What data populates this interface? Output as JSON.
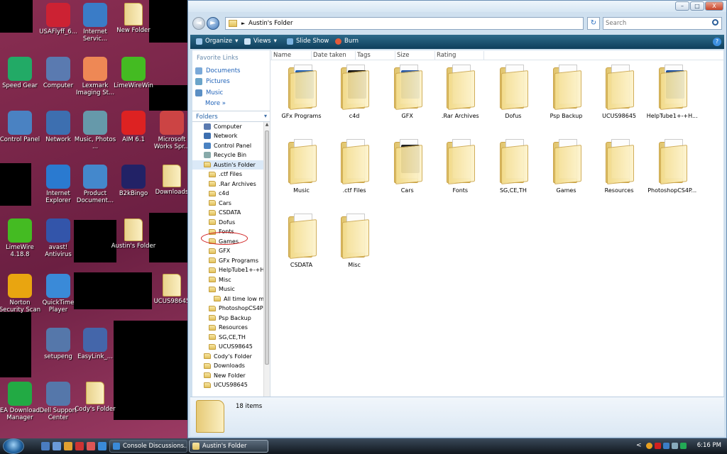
{
  "desktop": {
    "icons": [
      {
        "label": "USAFlyff_6...",
        "col": "#c23"
      },
      {
        "label": "Internet Servic...",
        "col": "#3a7cc7"
      },
      {
        "label": "New Folder",
        "col": "folder"
      },
      {
        "label": "Speed Gear",
        "col": "#2a6"
      },
      {
        "label": "Computer",
        "col": "#5a7ab0"
      },
      {
        "label": "Lexmark Imaging St...",
        "col": "#e85"
      },
      {
        "label": "LimeWireWin",
        "col": "#4b2"
      },
      {
        "label": "Control Panel",
        "col": "#4a82c2"
      },
      {
        "label": "Network",
        "col": "#3d6fb0"
      },
      {
        "label": "Music, Photos ...",
        "col": "#69a"
      },
      {
        "label": "AIM 6.1",
        "col": "#d22"
      },
      {
        "label": "Microsoft Works Spr...",
        "col": "#c44"
      },
      {
        "label": "Internet Explorer",
        "col": "#2a7ad0"
      },
      {
        "label": "Product Document...",
        "col": "#48c"
      },
      {
        "label": "B2kBingo",
        "col": "#226"
      },
      {
        "label": "Downloads",
        "col": "folder"
      },
      {
        "label": "LimeWire 4.18.8",
        "col": "#4b2"
      },
      {
        "label": "avast! Antivirus",
        "col": "#35a"
      },
      {
        "label": "Austin's Folder",
        "col": "folder"
      },
      {
        "label": "UCUS98645",
        "col": "folder"
      },
      {
        "label": "Norton Security Scan",
        "col": "#e9a510"
      },
      {
        "label": "QuickTime Player",
        "col": "#3a8ad8"
      },
      {
        "label": "setupeng",
        "col": "#5577aa"
      },
      {
        "label": "EasyLink_...",
        "col": "#46a"
      },
      {
        "label": "EA Download Manager",
        "col": "#2a4"
      },
      {
        "label": "Dell Support Center",
        "col": "#57a"
      },
      {
        "label": "Cody's Folder",
        "col": "folder"
      }
    ]
  },
  "window": {
    "address": {
      "separator": "►",
      "path": "Austin's Folder"
    },
    "search": {
      "placeholder": "Search"
    },
    "buttons": {
      "minimize": "–",
      "maximize": "□",
      "close": "X",
      "back": "◄",
      "forward": "►",
      "refresh": "↻",
      "help": "?"
    },
    "toolbar": {
      "organize": "Organize",
      "views": "Views",
      "slideshow": "Slide Show",
      "burn": "Burn",
      "dropdown": "▾"
    },
    "favorites": {
      "title": "Favorite Links",
      "items": [
        "Documents",
        "Pictures",
        "Music"
      ],
      "more": "More »"
    },
    "folders_header": "Folders",
    "folders_chevron": "▾",
    "tree": [
      {
        "label": "Computer",
        "indent": 0,
        "type": "sys",
        "col": "#5a7ab0"
      },
      {
        "label": "Network",
        "indent": 0,
        "type": "sys",
        "col": "#3d6fb0"
      },
      {
        "label": "Control Panel",
        "indent": 0,
        "type": "sys",
        "col": "#4a82c2"
      },
      {
        "label": "Recycle Bin",
        "indent": 0,
        "type": "sys",
        "col": "#8aa"
      },
      {
        "label": "Austin's Folder",
        "indent": 0,
        "type": "folder",
        "sel": true
      },
      {
        "label": ".ctf Files",
        "indent": 1,
        "type": "folder"
      },
      {
        "label": ".Rar Archives",
        "indent": 1,
        "type": "folder"
      },
      {
        "label": "c4d",
        "indent": 1,
        "type": "folder"
      },
      {
        "label": "Cars",
        "indent": 1,
        "type": "folder"
      },
      {
        "label": "CSDATA",
        "indent": 1,
        "type": "folder"
      },
      {
        "label": "Dofus",
        "indent": 1,
        "type": "folder"
      },
      {
        "label": "Fonts",
        "indent": 1,
        "type": "folder"
      },
      {
        "label": "Games",
        "indent": 1,
        "type": "folder"
      },
      {
        "label": "GFX",
        "indent": 1,
        "type": "folder"
      },
      {
        "label": "GFx Programs",
        "indent": 1,
        "type": "folder"
      },
      {
        "label": "HelpTube1+-+H",
        "indent": 1,
        "type": "folder"
      },
      {
        "label": "Misc",
        "indent": 1,
        "type": "folder"
      },
      {
        "label": "Music",
        "indent": 1,
        "type": "folder"
      },
      {
        "label": "All time low m",
        "indent": 2,
        "type": "folder"
      },
      {
        "label": "PhotoshopCS4P",
        "indent": 1,
        "type": "folder"
      },
      {
        "label": "Psp Backup",
        "indent": 1,
        "type": "folder"
      },
      {
        "label": "Resources",
        "indent": 1,
        "type": "folder"
      },
      {
        "label": "SG,CE,TH",
        "indent": 1,
        "type": "folder"
      },
      {
        "label": "UCUS98645",
        "indent": 1,
        "type": "folder"
      },
      {
        "label": "Cody's Folder",
        "indent": 0,
        "type": "folder"
      },
      {
        "label": "Downloads",
        "indent": 0,
        "type": "folder"
      },
      {
        "label": "New Folder",
        "indent": 0,
        "type": "folder"
      },
      {
        "label": "UCUS98645",
        "indent": 0,
        "type": "folder"
      }
    ],
    "tree_scroll": {
      "up": "▲",
      "down": "▼"
    },
    "columns": [
      "Name",
      "Date taken",
      "Tags",
      "Size",
      "Rating"
    ],
    "files": [
      {
        "label": "GFx Programs",
        "thumb": "#1f5fb0"
      },
      {
        "label": "c4d",
        "thumb": "#111"
      },
      {
        "label": "GFX",
        "thumb": "#2b5aa6"
      },
      {
        "label": ".Rar Archives",
        "thumb": ""
      },
      {
        "label": "Dofus",
        "thumb": ""
      },
      {
        "label": "Psp Backup",
        "thumb": ""
      },
      {
        "label": "UCUS98645",
        "thumb": ""
      },
      {
        "label": "HelpTube1+-+H...",
        "thumb": "#1c4f9c"
      },
      {
        "label": "Music",
        "thumb": ""
      },
      {
        "label": ".ctf Files",
        "thumb": ""
      },
      {
        "label": "Cars",
        "thumb": "#222"
      },
      {
        "label": "Fonts",
        "thumb": ""
      },
      {
        "label": "SG,CE,TH",
        "thumb": ""
      },
      {
        "label": "Games",
        "thumb": ""
      },
      {
        "label": "Resources",
        "thumb": ""
      },
      {
        "label": "PhotoshopCS4P...",
        "thumb": ""
      },
      {
        "label": "CSDATA",
        "thumb": ""
      },
      {
        "label": "Misc",
        "thumb": ""
      }
    ],
    "details": {
      "count": "18 items"
    }
  },
  "taskbar": {
    "tasks": [
      {
        "label": "Console Discussions...",
        "active": false
      },
      {
        "label": "Austin's Folder",
        "active": true
      }
    ],
    "tray_expand": "<",
    "clock": "6:16 PM"
  }
}
